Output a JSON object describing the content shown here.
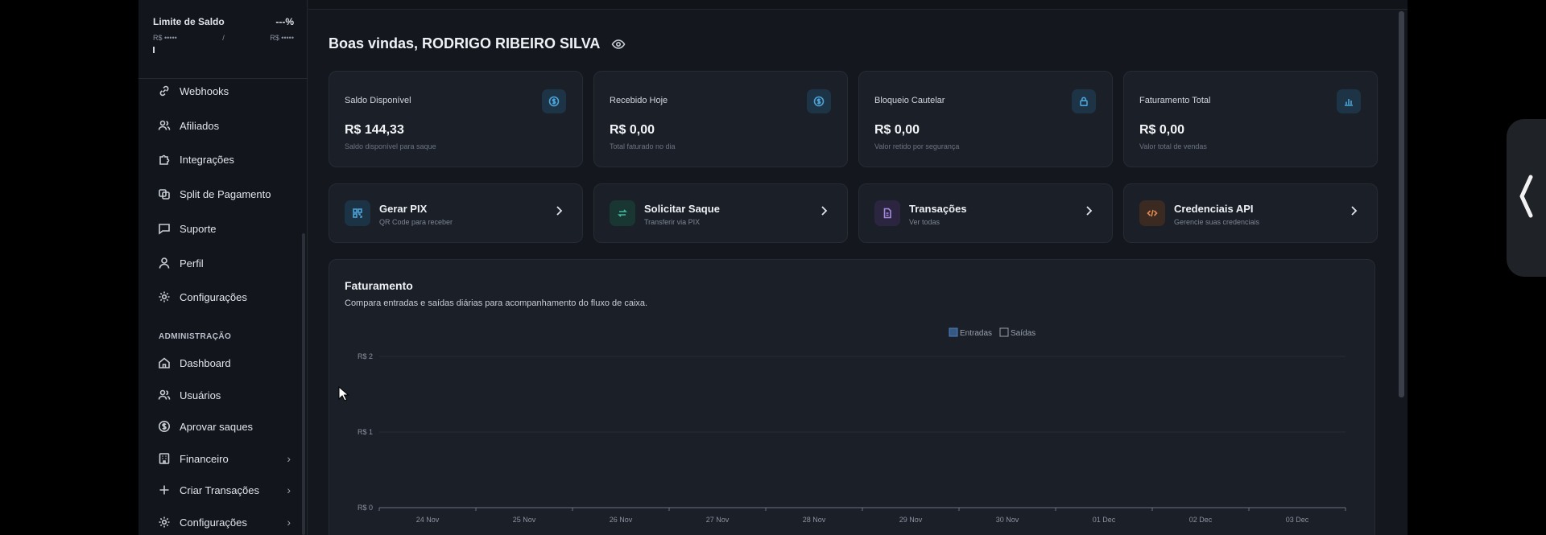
{
  "balance_limit": {
    "title": "Limite de Saldo",
    "percent": "---%",
    "left_value": "R$ •••••",
    "separator": "/",
    "right_value": "R$ •••••"
  },
  "sidebar": {
    "items": [
      {
        "label": "Webhooks",
        "icon": "link-icon"
      },
      {
        "label": "Afiliados",
        "icon": "users-icon"
      },
      {
        "label": "Integrações",
        "icon": "puzzle-icon"
      },
      {
        "label": "Split de Pagamento",
        "icon": "split-icon"
      },
      {
        "label": "Suporte",
        "icon": "message-icon"
      },
      {
        "label": "Perfil",
        "icon": "user-icon"
      },
      {
        "label": "Configurações",
        "icon": "gear-icon"
      }
    ],
    "admin_heading": "ADMINISTRAÇÃO",
    "admin_items": [
      {
        "label": "Dashboard",
        "icon": "home-icon"
      },
      {
        "label": "Usuários",
        "icon": "users-icon"
      },
      {
        "label": "Aprovar saques",
        "icon": "dollar-circle-icon"
      },
      {
        "label": "Financeiro",
        "icon": "bank-icon"
      },
      {
        "label": "Criar Transações",
        "icon": "plus-icon"
      },
      {
        "label": "Configurações",
        "icon": "gear-icon"
      }
    ]
  },
  "welcome": {
    "text": "Boas vindas, RODRIGO RIBEIRO SILVA",
    "icon": "eye-icon"
  },
  "stats": [
    {
      "label": "Saldo Disponível",
      "value": "R$ 144,33",
      "sub": "Saldo disponível para saque",
      "icon": "dollar-icon"
    },
    {
      "label": "Recebido Hoje",
      "value": "R$ 0,00",
      "sub": "Total faturado no dia",
      "icon": "dollar-icon"
    },
    {
      "label": "Bloqueio Cautelar",
      "value": "R$ 0,00",
      "sub": "Valor retido por segurança",
      "icon": "lock-icon"
    },
    {
      "label": "Faturamento Total",
      "value": "R$ 0,00",
      "sub": "Valor total de vendas",
      "icon": "bar-chart-icon"
    }
  ],
  "actions": [
    {
      "title": "Gerar PIX",
      "sub": "QR Code para receber",
      "icon": "qr-code-icon",
      "color": "#4da3d8"
    },
    {
      "title": "Solicitar Saque",
      "sub": "Transferir via PIX",
      "icon": "arrows-icon",
      "color": "#3fb89b"
    },
    {
      "title": "Transações",
      "sub": "Ver todas",
      "icon": "document-icon",
      "color": "#a58ae0"
    },
    {
      "title": "Credenciais API",
      "sub": "Gerencie suas credenciais",
      "icon": "code-icon",
      "color": "#e0894f"
    }
  ],
  "chart_panel": {
    "title": "Faturamento",
    "description": "Compara entradas e saídas diárias para acompanhamento do fluxo de caixa."
  },
  "chart_data": {
    "type": "bar",
    "categories": [
      "24 Nov",
      "25 Nov",
      "26 Nov",
      "27 Nov",
      "28 Nov",
      "29 Nov",
      "30 Nov",
      "01 Dec",
      "02 Dec",
      "03 Dec"
    ],
    "series": [
      {
        "name": "Entradas",
        "values": [
          0,
          0,
          0,
          0,
          0,
          0,
          0,
          0,
          0,
          0
        ],
        "color": "#4a7fc1"
      },
      {
        "name": "Saídas",
        "values": [
          0,
          0,
          0,
          0,
          0,
          0,
          0,
          0,
          0,
          0
        ],
        "color": "#9aa2ae"
      }
    ],
    "y_ticks": [
      "R$ 0",
      "R$ 1",
      "R$ 2"
    ],
    "ylim": [
      0,
      2
    ],
    "legend": "top-center",
    "grid": true
  },
  "colors": {
    "background": "#14171d",
    "card": "#1b1f27",
    "accent_blue": "#4da3d8"
  }
}
